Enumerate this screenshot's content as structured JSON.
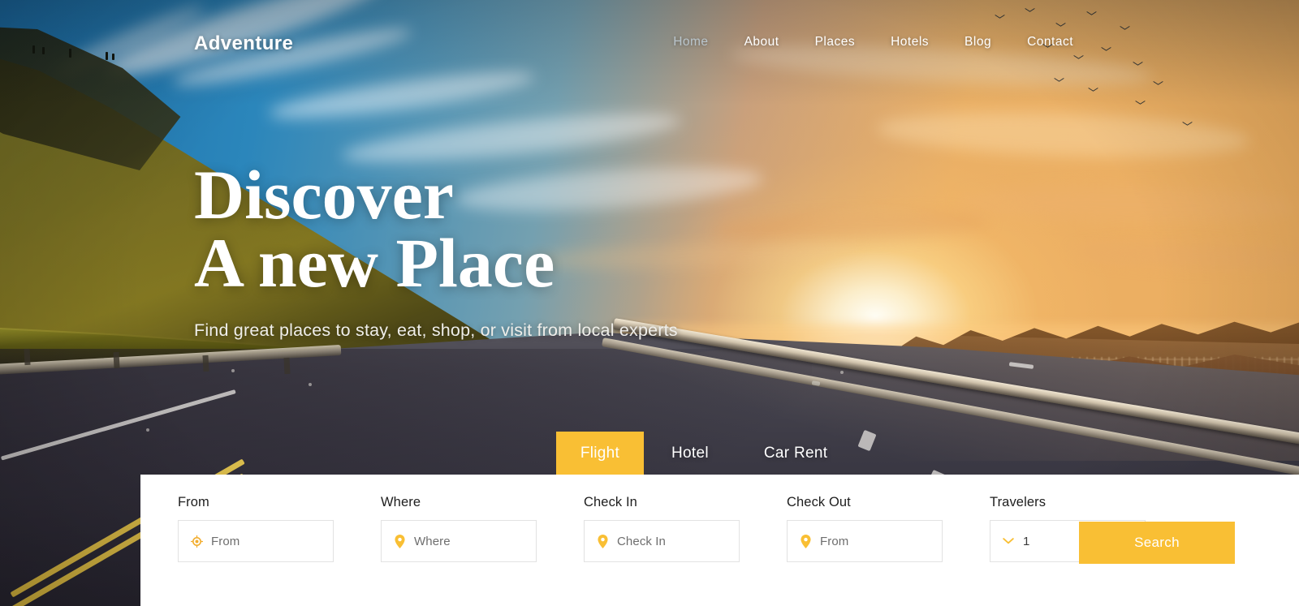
{
  "brand": {
    "name": "Adventure"
  },
  "nav": {
    "items": [
      {
        "label": "Home",
        "active": true
      },
      {
        "label": "About",
        "active": false
      },
      {
        "label": "Places",
        "active": false
      },
      {
        "label": "Hotels",
        "active": false
      },
      {
        "label": "Blog",
        "active": false
      },
      {
        "label": "Contact",
        "active": false
      }
    ]
  },
  "hero": {
    "title": "Discover\nA new Place",
    "subtitle": "Find great places to stay, eat, shop, or visit from local experts"
  },
  "tabs": [
    {
      "label": "Flight",
      "active": true
    },
    {
      "label": "Hotel",
      "active": false
    },
    {
      "label": "Car Rent",
      "active": false
    }
  ],
  "search_form": {
    "fields": [
      {
        "label": "From",
        "placeholder": "From",
        "value": "",
        "icon": "gps-target-icon"
      },
      {
        "label": "Where",
        "placeholder": "Where",
        "value": "",
        "icon": "map-pin-icon"
      },
      {
        "label": "Check In",
        "placeholder": "Check In",
        "value": "",
        "icon": "map-pin-icon"
      },
      {
        "label": "Check Out",
        "placeholder": "From",
        "value": "",
        "icon": "map-pin-icon"
      },
      {
        "label": "Travelers",
        "placeholder": "",
        "value": "1",
        "icon": "chevron-down-icon"
      }
    ],
    "submit_label": "Search"
  },
  "colors": {
    "accent": "#f9bf34",
    "panel_bg": "#ffffff",
    "nav_active": "#b9c5cc",
    "field_border": "#e2e2e2",
    "label_text": "#1e1e1e",
    "placeholder_text": "#6e6e6e"
  }
}
